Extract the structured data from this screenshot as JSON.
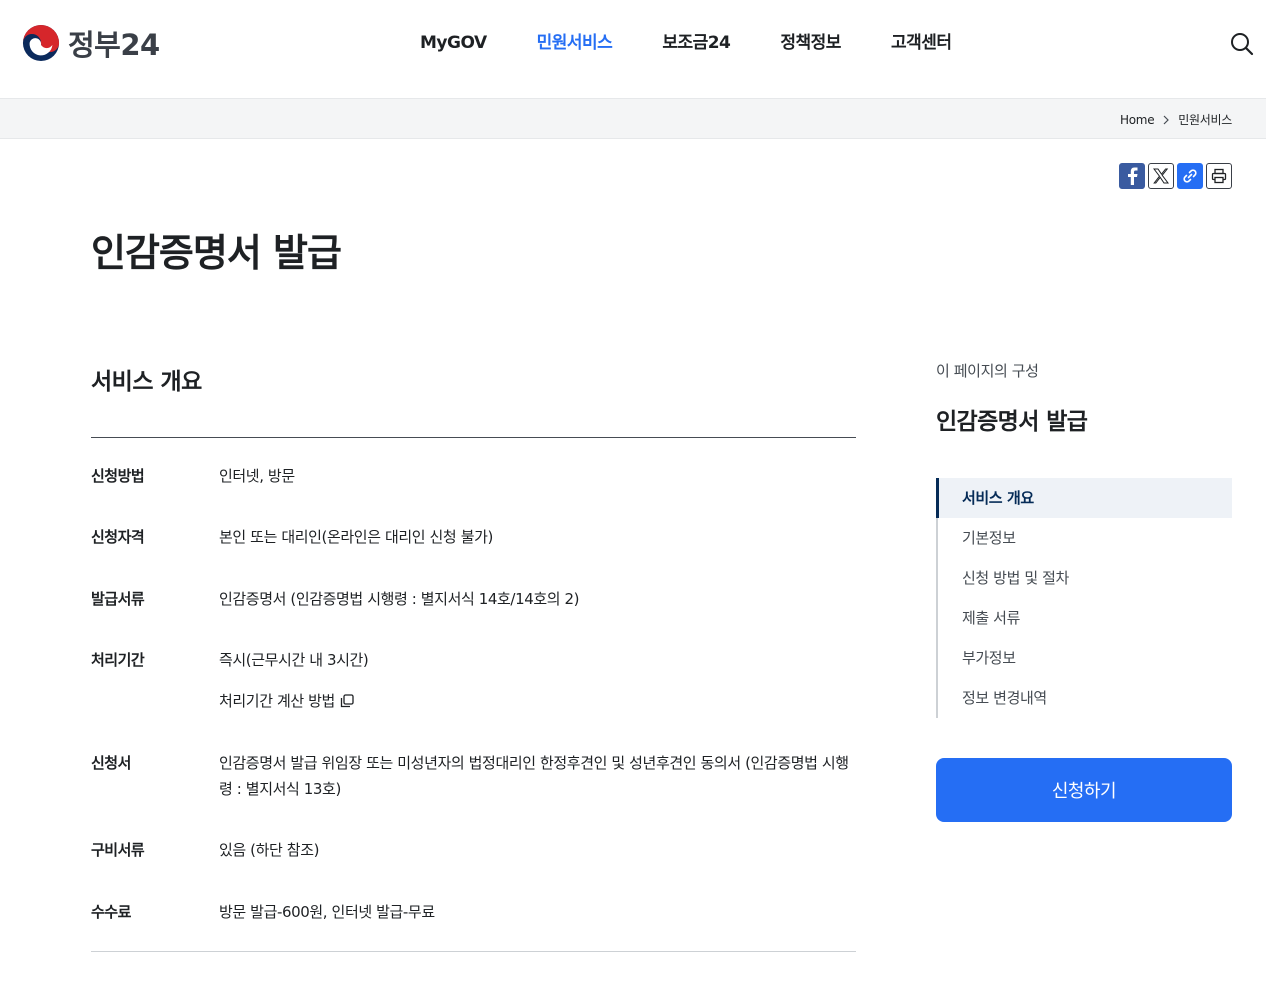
{
  "header": {
    "logo_text": "정부24",
    "nav": [
      {
        "label": "MyGOV",
        "active": false
      },
      {
        "label": "민원서비스",
        "active": true
      },
      {
        "label": "보조금24",
        "active": false
      },
      {
        "label": "정책정보",
        "active": false
      },
      {
        "label": "고객센터",
        "active": false
      }
    ]
  },
  "breadcrumb": {
    "home": "Home",
    "current": "민원서비스"
  },
  "page": {
    "title": "인감증명서 발급"
  },
  "overview": {
    "section_title": "서비스 개요",
    "rows": [
      {
        "label": "신청방법",
        "value": "인터넷, 방문"
      },
      {
        "label": "신청자격",
        "value": "본인 또는 대리인(온라인은 대리인 신청 불가)"
      },
      {
        "label": "발급서류",
        "value": "인감증명서 (인감증명법 시행령 : 별지서식 14호/14호의 2)"
      },
      {
        "label": "처리기간",
        "value": "즉시(근무시간 내 3시간)",
        "link": "처리기간 계산 방법"
      },
      {
        "label": "신청서",
        "value": "인감증명서 발급 위임장 또는 미성년자의 법정대리인 한정후견인 및 성년후견인 동의서 (인감증명법 시행령 : 별지서식 13호)"
      },
      {
        "label": "구비서류",
        "value": "있음 (하단 참조)"
      },
      {
        "label": "수수료",
        "value": "방문 발급-600원, 인터넷 발급-무료"
      }
    ]
  },
  "sidebar": {
    "caption": "이 페이지의 구성",
    "title": "인감증명서 발급",
    "toc": [
      {
        "label": "서비스 개요",
        "active": true
      },
      {
        "label": "기본정보",
        "active": false
      },
      {
        "label": "신청 방법 및 절차",
        "active": false
      },
      {
        "label": "제출 서류",
        "active": false
      },
      {
        "label": "부가정보",
        "active": false
      },
      {
        "label": "정보 변경내역",
        "active": false
      }
    ],
    "apply_label": "신청하기"
  },
  "colors": {
    "accent": "#256ef4",
    "toc_active": "#052b57"
  }
}
